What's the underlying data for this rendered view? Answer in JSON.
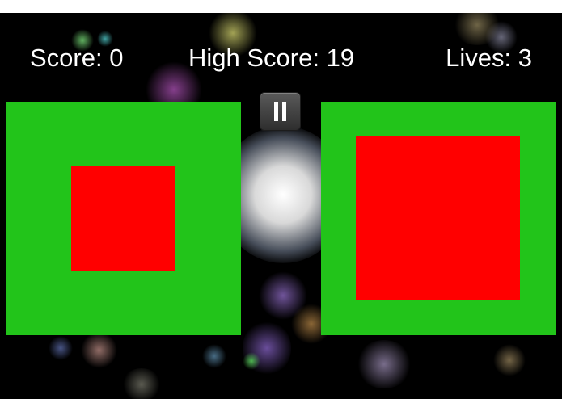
{
  "hud": {
    "score_text": "Score: 0",
    "high_score_text": "High Score: 19",
    "lives_text": "Lives: 3"
  },
  "pause_button": {
    "icon": "pause-icon"
  },
  "colors": {
    "background": "#000000",
    "panel": "#22c41a",
    "target": "#ff0000",
    "text": "#ffffff",
    "top_strip": "#ffffff"
  }
}
